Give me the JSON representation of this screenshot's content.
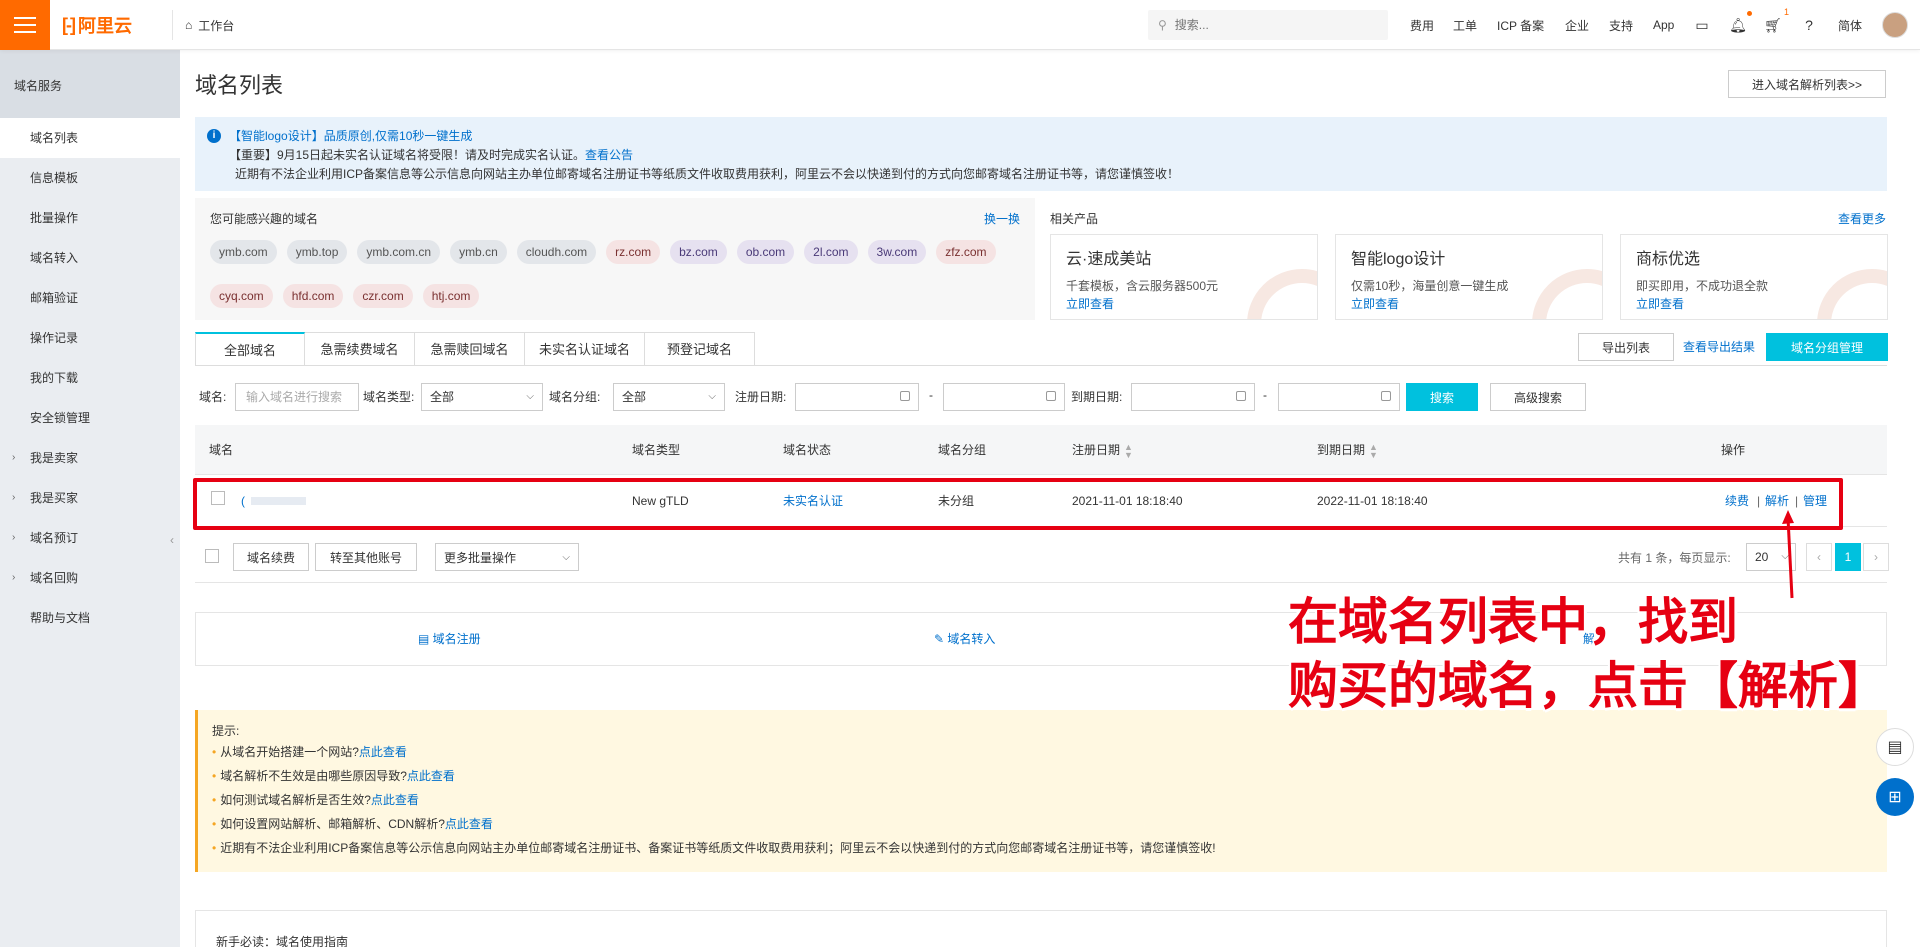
{
  "topbar": {
    "logo_mark": "[-]",
    "logo_text": "阿里云",
    "workbench": "工作台",
    "search_placeholder": "搜索...",
    "nav": [
      "费用",
      "工单",
      "ICP 备案",
      "企业",
      "支持",
      "App"
    ],
    "language": "简体",
    "cart_badge": "1"
  },
  "sidebar": {
    "title": "域名服务",
    "items": [
      {
        "label": "域名列表",
        "active": true,
        "expandable": false
      },
      {
        "label": "信息模板",
        "active": false,
        "expandable": false
      },
      {
        "label": "批量操作",
        "active": false,
        "expandable": false
      },
      {
        "label": "域名转入",
        "active": false,
        "expandable": false
      },
      {
        "label": "邮箱验证",
        "active": false,
        "expandable": false
      },
      {
        "label": "操作记录",
        "active": false,
        "expandable": false
      },
      {
        "label": "我的下载",
        "active": false,
        "expandable": false
      },
      {
        "label": "安全锁管理",
        "active": false,
        "expandable": false
      },
      {
        "label": "我是卖家",
        "active": false,
        "expandable": true
      },
      {
        "label": "我是买家",
        "active": false,
        "expandable": true
      },
      {
        "label": "域名预订",
        "active": false,
        "expandable": true
      },
      {
        "label": "域名回购",
        "active": false,
        "expandable": true
      },
      {
        "label": "帮助与文档",
        "active": false,
        "expandable": false
      }
    ]
  },
  "main": {
    "title": "域名列表",
    "goto_dns": "进入域名解析列表>>",
    "notice": {
      "line1": "【智能logo设计】品质原创,仅需10秒一键生成",
      "line2_text": "【重要】9月15日起未实名认证域名将受限！请及时完成实名认证。",
      "line2_link": "查看公告",
      "line3": "近期有不法企业利用ICP备案信息等公示信息向网站主办单位邮寄域名注册证书等纸质文件收取费用获利，阿里云不会以快递到付的方式向您邮寄域名注册证书等，请您谨慎签收！"
    },
    "suggest": {
      "title": "您可能感兴趣的域名",
      "refresh": "换一换",
      "chips_row1": [
        "ymb.com",
        "ymb.top",
        "ymb.com.cn",
        "ymb.cn",
        "cloudh.com",
        "rz.com",
        "bz.com",
        "ob.com",
        "2l.com",
        "3w.com",
        "zfz.com"
      ],
      "chips_row2": [
        "cyq.com",
        "hfd.com",
        "czr.com",
        "htj.com"
      ]
    },
    "related": {
      "title": "相关产品",
      "more": "查看更多",
      "products": [
        {
          "title": "云·速成美站",
          "desc": "千套模板，含云服务器500元",
          "link": "立即查看"
        },
        {
          "title": "智能logo设计",
          "desc": "仅需10秒，海量创意一键生成",
          "link": "立即查看"
        },
        {
          "title": "商标优选",
          "desc": "即买即用，不成功退全款",
          "link": "立即查看"
        }
      ]
    },
    "tabs": [
      "全部域名",
      "急需续费域名",
      "急需赎回域名",
      "未实名认证域名",
      "预登记域名"
    ],
    "export_list": "导出列表",
    "export_result": "查看导出结果",
    "group_mgmt": "域名分组管理",
    "filters": {
      "domain_label": "域名:",
      "domain_placeholder": "输入域名进行搜索",
      "type_label": "域名类型:",
      "type_value": "全部",
      "group_label": "域名分组:",
      "group_value": "全部",
      "reg_label": "注册日期:",
      "exp_label": "到期日期:",
      "dash": "-",
      "search": "搜索",
      "advanced": "高级搜索"
    },
    "table": {
      "headers": [
        "域名",
        "域名类型",
        "域名状态",
        "域名分组",
        "注册日期",
        "到期日期",
        "操作"
      ],
      "rows": [
        {
          "domain": "(",
          "type": "New gTLD",
          "status": "未实名认证",
          "group": "未分组",
          "reg_date": "2021-11-01 18:18:40",
          "exp_date": "2022-11-01 18:18:40",
          "actions": [
            "续费",
            "解析",
            "管理"
          ]
        }
      ],
      "sep": "|"
    },
    "batch": {
      "renew": "域名续费",
      "transfer": "转至其他账号",
      "more": "更多批量操作",
      "total": "共有 1 条，每页显示:",
      "page_size": "20",
      "prev": "‹",
      "current_page": "1",
      "next": "›"
    },
    "quick": {
      "register": "域名注册",
      "transfer_in": "域名转入",
      "partial": "解"
    },
    "tips": {
      "title": "提示:",
      "items": [
        {
          "text": "从域名开始搭建一个网站?",
          "link": "点此查看"
        },
        {
          "text": "域名解析不生效是由哪些原因导致?",
          "link": "点此查看"
        },
        {
          "text": "如何测试域名解析是否生效?",
          "link": "点此查看"
        },
        {
          "text": "如何设置网站解析、邮箱解析、CDN解析?",
          "link": "点此查看"
        },
        {
          "text": "近期有不法企业利用ICP备案信息等公示信息向网站主办单位邮寄域名注册证书、备案证书等纸质文件收取费用获利；阿里云不会以快递到付的方式向您邮寄域名注册证书等，请您谨慎签收!",
          "link": ""
        }
      ]
    },
    "guide": "新手必读：域名使用指南"
  },
  "annotation": {
    "line1": "在域名列表中，找到",
    "line2": "购买的域名，点击【解析】"
  },
  "colors": {
    "accent": "#00c1de",
    "brand": "#ff6a00",
    "link": "#0070cc",
    "annotation": "#e60012"
  }
}
